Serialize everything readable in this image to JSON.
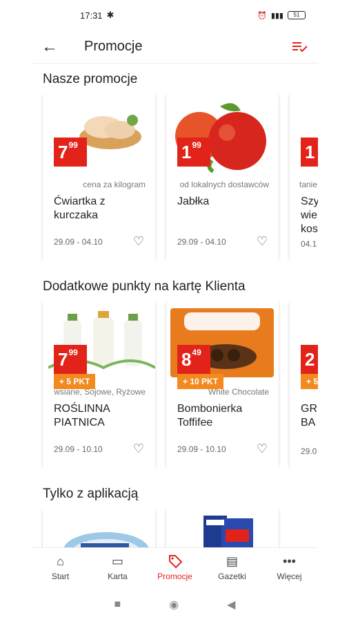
{
  "status": {
    "time": "17:31",
    "battery": "51"
  },
  "appbar": {
    "title": "Promocje"
  },
  "sections": {
    "promos": {
      "title": "Nasze promocje",
      "cards": [
        {
          "price_int": "7",
          "price_dec": "99",
          "subtitle": "cena za kilogram",
          "name": "Ćwiartka z kurczaka",
          "dates": "29.09 - 04.10"
        },
        {
          "price_int": "1",
          "price_dec": "99",
          "subtitle": "od lokalnych dostawców",
          "name": "Jabłka",
          "dates": "29.09 - 04.10"
        },
        {
          "price_int": "1",
          "price_dec": "",
          "subtitle": "tanie",
          "name": "Szy wie kos",
          "dates": "04.1"
        }
      ]
    },
    "points": {
      "title": "Dodatkowe punkty na kartę Klienta",
      "cards": [
        {
          "price_int": "7",
          "price_dec": "99",
          "points": "+ 5 PKT",
          "subtitle": "wsiane, Sojowe, Ryżowe",
          "name": "ROŚLINNA PIĄTNICA",
          "dates": "29.09 - 10.10"
        },
        {
          "price_int": "8",
          "price_dec": "49",
          "points": "+ 10 PKT",
          "subtitle": "White Chocolate",
          "name": "Bombonierka Toffifee",
          "dates": "29.09 - 10.10"
        },
        {
          "price_int": "2",
          "price_dec": "",
          "points": "+ 5",
          "subtitle": "",
          "name": "GR BA",
          "dates": "29.0"
        }
      ]
    },
    "app_only": {
      "title": "Tylko z aplikacją"
    }
  },
  "nav": [
    {
      "label": "Start"
    },
    {
      "label": "Karta"
    },
    {
      "label": "Promocje"
    },
    {
      "label": "Gazetki"
    },
    {
      "label": "Więcej"
    }
  ],
  "colors": {
    "accent": "#e2231a",
    "points": "#f38a1f"
  }
}
